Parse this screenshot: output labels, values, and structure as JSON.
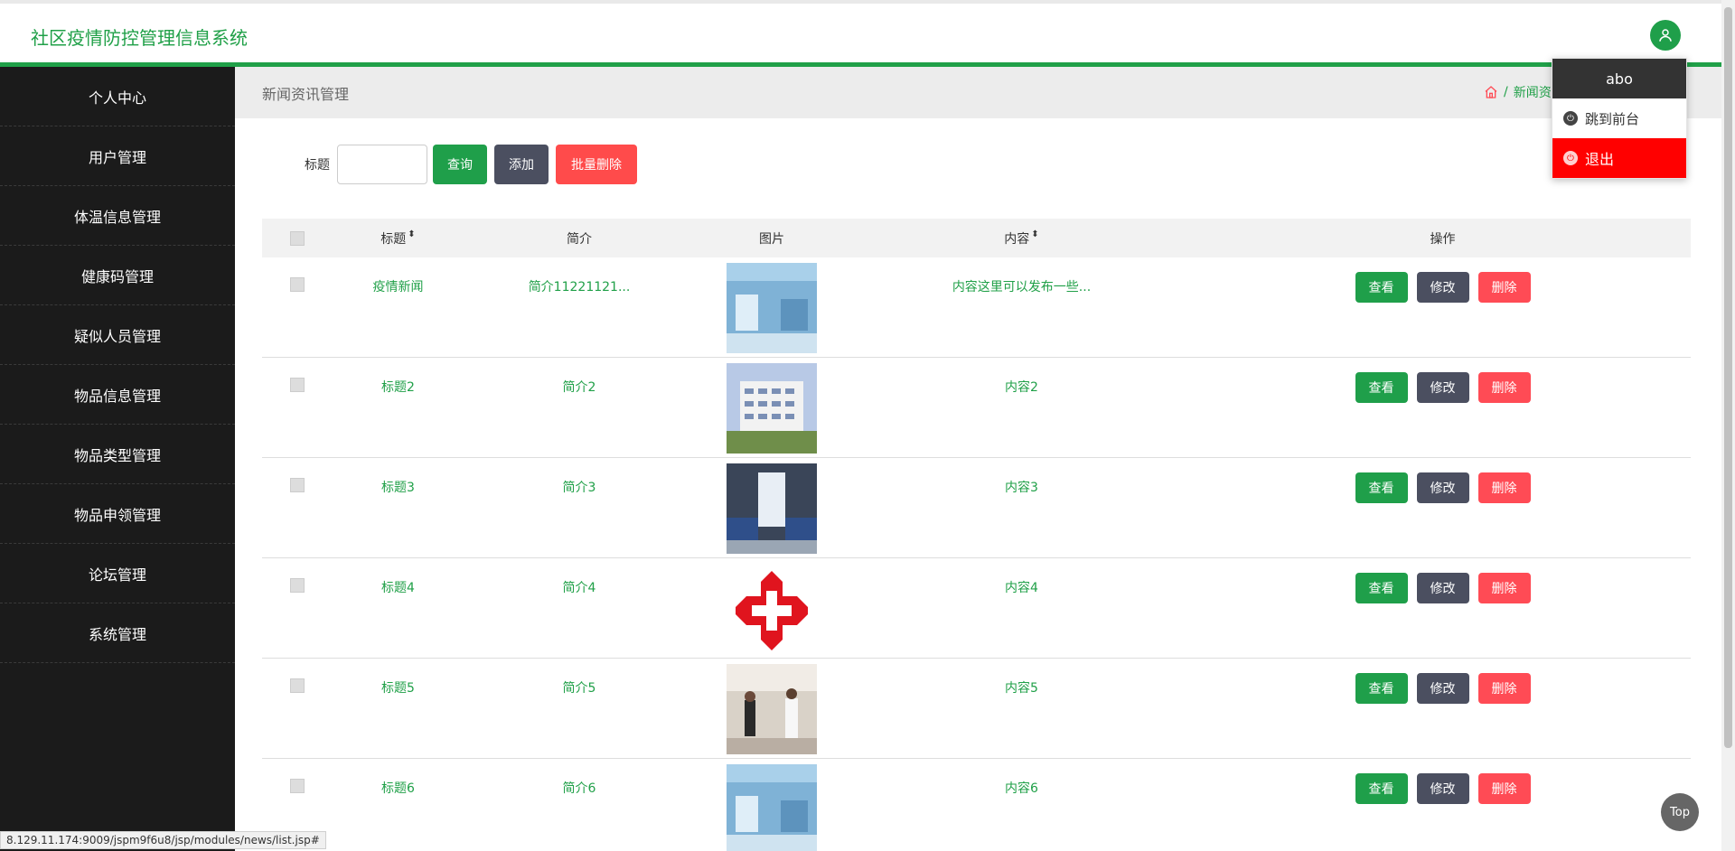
{
  "header": {
    "app_title": "社区疫情防控管理信息系统"
  },
  "sidebar": {
    "items": [
      {
        "label": "个人中心"
      },
      {
        "label": "用户管理"
      },
      {
        "label": "体温信息管理"
      },
      {
        "label": "健康码管理"
      },
      {
        "label": "疑似人员管理"
      },
      {
        "label": "物品信息管理"
      },
      {
        "label": "物品类型管理"
      },
      {
        "label": "物品申领管理"
      },
      {
        "label": "论坛管理"
      },
      {
        "label": "系统管理"
      }
    ]
  },
  "breadcrumb": {
    "page_title": "新闻资讯管理",
    "current": "新闻资"
  },
  "search": {
    "label": "标题",
    "value": "",
    "search_button": "查询",
    "add_button": "添加",
    "batch_delete_button": "批量删除"
  },
  "table": {
    "headers": {
      "title": "标题",
      "intro": "简介",
      "image": "图片",
      "content": "内容",
      "ops": "操作"
    },
    "rows": [
      {
        "title": "疫情新闻",
        "intro": "简介11221121...",
        "content": "内容这里可以发布一些..."
      },
      {
        "title": "标题2",
        "intro": "简介2",
        "content": "内容2"
      },
      {
        "title": "标题3",
        "intro": "简介3",
        "content": "内容3"
      },
      {
        "title": "标题4",
        "intro": "简介4",
        "content": "内容4"
      },
      {
        "title": "标题5",
        "intro": "简介5",
        "content": "内容5"
      },
      {
        "title": "标题6",
        "intro": "简介6",
        "content": "内容6"
      }
    ],
    "ops": {
      "view": "查看",
      "edit": "修改",
      "delete": "删除"
    }
  },
  "dropdown": {
    "username": "abo",
    "to_front": "跳到前台",
    "logout": "退出"
  },
  "top_button": "Top",
  "status_url": "8.129.11.174:9009/jspm9f6u8/jsp/modules/news/list.jsp#",
  "colors": {
    "brand_green": "#20a048",
    "danger": "#ff4b55",
    "dark": "#4b4f60",
    "sidebar_bg": "#1b1b1b"
  }
}
